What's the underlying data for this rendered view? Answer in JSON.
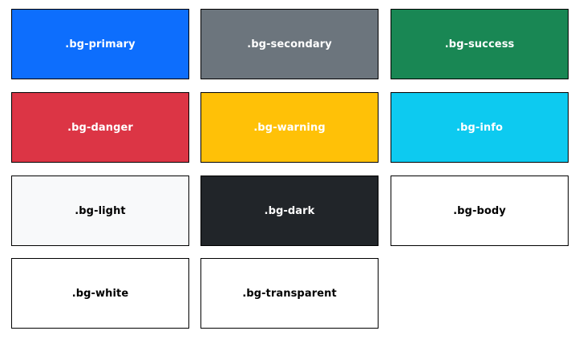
{
  "swatches": [
    {
      "label": ".bg-primary",
      "bg": "#0d6efd",
      "fg": "#ffffff"
    },
    {
      "label": ".bg-secondary",
      "bg": "#6c757d",
      "fg": "#ffffff"
    },
    {
      "label": ".bg-success",
      "bg": "#198754",
      "fg": "#ffffff"
    },
    {
      "label": ".bg-danger",
      "bg": "#dc3545",
      "fg": "#ffffff"
    },
    {
      "label": ".bg-warning",
      "bg": "#ffc107",
      "fg": "#ffffff"
    },
    {
      "label": ".bg-info",
      "bg": "#0dcaf0",
      "fg": "#ffffff"
    },
    {
      "label": ".bg-light",
      "bg": "#f8f9fa",
      "fg": "#000000"
    },
    {
      "label": ".bg-dark",
      "bg": "#212529",
      "fg": "#ffffff"
    },
    {
      "label": ".bg-body",
      "bg": "#ffffff",
      "fg": "#000000"
    },
    {
      "label": ".bg-white",
      "bg": "#ffffff",
      "fg": "#000000"
    },
    {
      "label": ".bg-transparent",
      "bg": "transparent",
      "fg": "#000000"
    }
  ]
}
